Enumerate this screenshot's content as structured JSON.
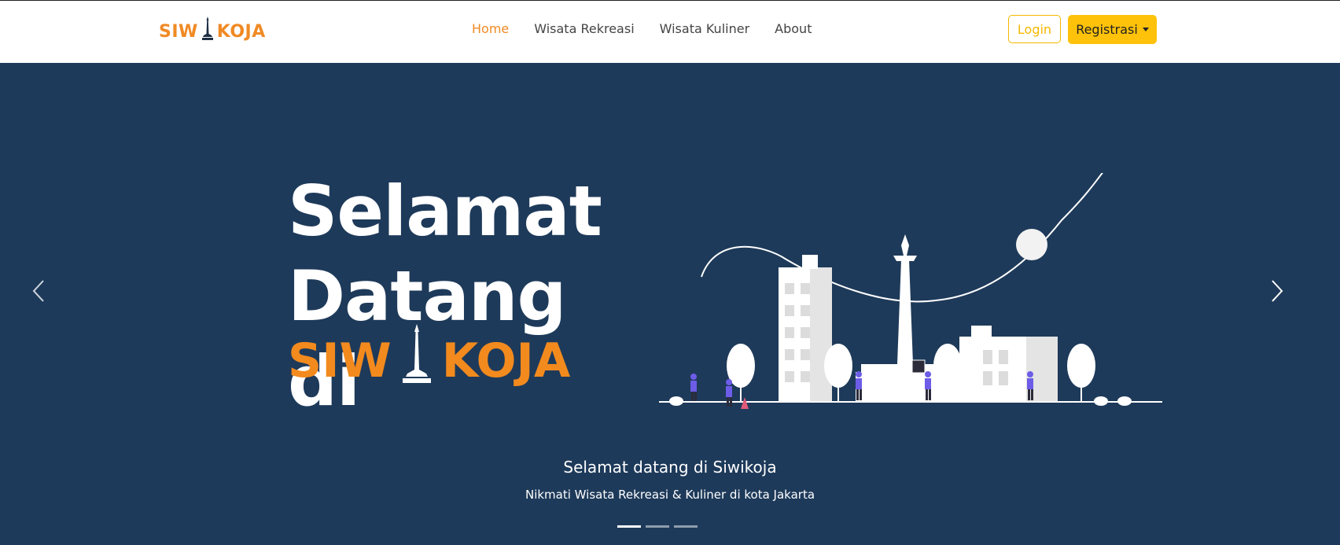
{
  "navbar": {
    "brand": "SIWIKOJA",
    "links": [
      "Home",
      "Wisata Rekreasi",
      "Wisata Kuliner",
      "About"
    ],
    "active": "Home",
    "login_label": "Login",
    "register_label": "Registrasi"
  },
  "hero": {
    "title_line1": "Selamat",
    "title_line2": "Datang di",
    "brand": "SIWIKOJA",
    "caption_title": "Selamat datang di Siwikoja",
    "caption_subtitle": "Nikmati Wisata Rekreasi & Kuliner di kota Jakarta",
    "slides": 3,
    "active_slide": 1
  },
  "colors": {
    "accent": "#f08a24",
    "hero_bg": "#1e3a5a",
    "button_yellow": "#ffc20a"
  },
  "icons": {
    "prev": "chevron-left-icon",
    "next": "chevron-right-icon",
    "dropdown": "caret-down-icon",
    "logo_monument": "monas-icon"
  }
}
